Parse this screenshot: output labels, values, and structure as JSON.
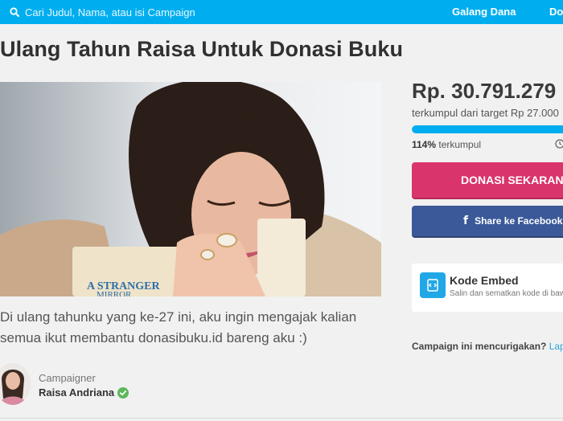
{
  "header": {
    "search_placeholder": "Cari Judul, Nama, atau isi Campaign",
    "nav_galang": "Galang Dana",
    "nav_cut": "Do"
  },
  "campaign": {
    "title": "Ulang Tahun Raisa Untuk Donasi Buku",
    "photo_book_text_1": "A STRANGER",
    "photo_book_text_2": "MIRROR",
    "description": "Di ulang tahunku yang ke-27 ini, aku ingin mengajak kalian semua ikut membantu donasibuku.id bareng aku :)",
    "campaigner_label": "Campaigner",
    "campaigner_name": "Raisa Andriana"
  },
  "donation": {
    "amount": "Rp. 30.791.279",
    "target_text": "terkumpul dari target Rp 27.000",
    "percent_value": "114%",
    "percent_label": " terkumpul",
    "progress_fraction": 1.0,
    "donate_label": "DONASI SEKARANG",
    "facebook_label": "Share ke Facebook"
  },
  "embed": {
    "title": "Kode Embed",
    "subtitle": "Salin dan sematkan kode di baw"
  },
  "report": {
    "question": "Campaign ini mencurigakan?",
    "link": "Lapo"
  },
  "colors": {
    "topbar": "#00aeef",
    "donate": "#d9346b",
    "facebook": "#3b5998",
    "progress": "#00aeef",
    "verified": "#5cb85c"
  },
  "icons": [
    "search-icon",
    "clock-icon",
    "facebook-icon",
    "embed-code-icon",
    "verified-check-icon"
  ]
}
